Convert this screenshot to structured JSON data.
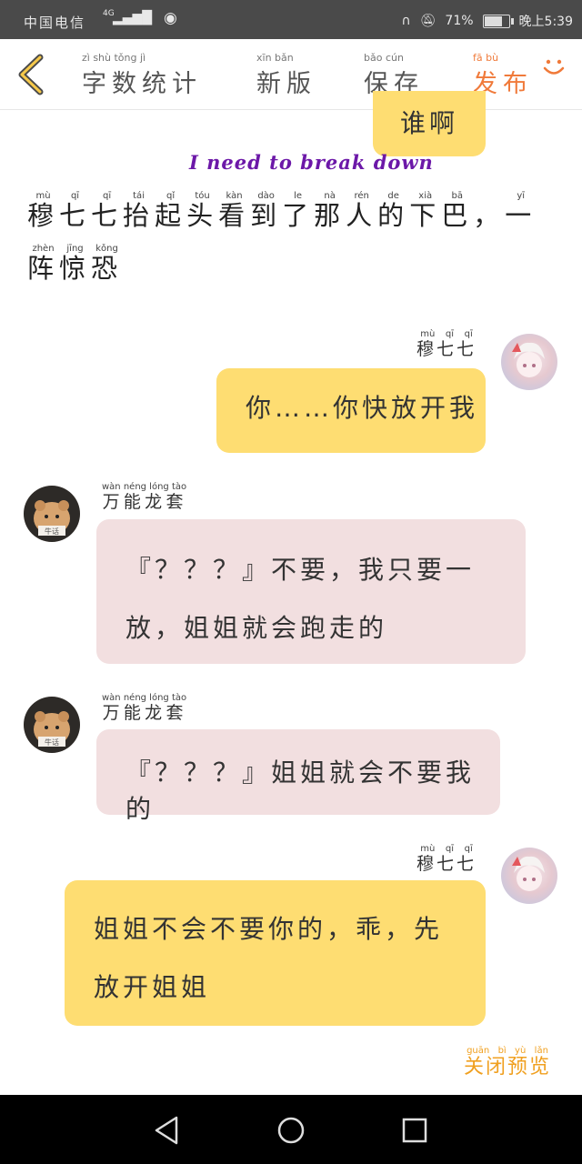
{
  "status_bar": {
    "carrier": "中国电信",
    "network": "4G",
    "battery": "71%",
    "time": "晚上5:39"
  },
  "toolbar": {
    "word_count": "字数统计",
    "word_count_py": "zì shù tǒng jì",
    "new_version": "新版",
    "new_version_py": "xīn bǎn",
    "save": "保存",
    "save_py": "bǎo cún",
    "publish": "发布",
    "publish_py": "fā bù"
  },
  "colors": {
    "accent_orange": "#f07a3a",
    "bubble_yellow": "#fedd72",
    "bubble_pink": "#f2dfe0",
    "title_purple": "#6c18a8"
  },
  "top_partial_bubble": "谁啊",
  "heading": "I need to break down",
  "narration": [
    {
      "c": "穆",
      "p": "mù"
    },
    {
      "c": "七",
      "p": "qī"
    },
    {
      "c": "七",
      "p": "qī"
    },
    {
      "c": "抬",
      "p": "tái"
    },
    {
      "c": "起",
      "p": "qǐ"
    },
    {
      "c": "头",
      "p": "tóu"
    },
    {
      "c": "看",
      "p": "kàn"
    },
    {
      "c": "到",
      "p": "dào"
    },
    {
      "c": "了",
      "p": "le"
    },
    {
      "c": "那",
      "p": "nà"
    },
    {
      "c": "人",
      "p": "rén"
    },
    {
      "c": "的",
      "p": "de"
    },
    {
      "c": "下",
      "p": "xià"
    },
    {
      "c": "巴",
      "p": "bā"
    },
    {
      "c": "，",
      "p": ""
    },
    {
      "c": "一",
      "p": "yī"
    },
    {
      "c": "阵",
      "p": "zhèn"
    },
    {
      "c": "惊",
      "p": "jīng"
    },
    {
      "c": "恐",
      "p": "kǒng"
    }
  ],
  "messages": [
    {
      "sender": "穆七七",
      "side": "right",
      "text": "你……你快放开我"
    },
    {
      "sender": "万能龙套",
      "side": "left",
      "text": "『？？？』不要，我只要一放，姐姐就会跑走的"
    },
    {
      "sender": "万能龙套",
      "side": "left",
      "text": "『？？？』姐姐就会不要我的"
    },
    {
      "sender": "穆七七",
      "side": "right",
      "text": "姐姐不会不要你的，乖，先放开姐姐"
    }
  ],
  "names": {
    "mu_qiqi": "穆七七",
    "mu_qiqi_py": "mù qī qī",
    "wanneng": "万能龙套",
    "wanneng_py": "wàn néng lóng tào"
  },
  "close_preview": "关闭预览",
  "close_preview_py": "guān bì yù lǎn",
  "avatar_badge": "牛话"
}
